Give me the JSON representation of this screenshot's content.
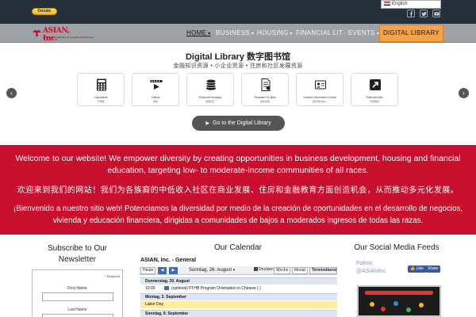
{
  "topbar": {
    "donate_label": "Donate",
    "language": "English",
    "social_icons": [
      "facebook-icon",
      "twitter-icon",
      "youtube-icon"
    ]
  },
  "nav": {
    "logo_text": "ASIAN, Inc.",
    "logo_tagline": "Empowering Minorities & Creating Opportunities",
    "items": [
      {
        "label": "HOME",
        "active": true
      },
      {
        "label": "BUSINESS",
        "active": false
      },
      {
        "label": "HOUSING",
        "active": false
      },
      {
        "label": "FINANCIAL LIT",
        "active": false
      },
      {
        "label": "EVENTS",
        "active": false
      }
    ],
    "digital_library": "DIGITAL LIBRARY",
    "accent_color": "#f5a24a"
  },
  "library": {
    "title": "Digital Library 数字图书馆",
    "subtitle": "金融知识资源 • 小企业资源 • 住房和社区发展资源",
    "tiles": [
      {
        "label": "Calculators",
        "sub": "计算器",
        "icon": "calculator-icon"
      },
      {
        "label": "Videos",
        "sub": "视频",
        "icon": "video-icon"
      },
      {
        "label": "Financial Glossary",
        "sub": "金融词汇",
        "icon": "coins-icon"
      },
      {
        "label": "Request For Bids",
        "sub": "招标请求",
        "icon": "document-icon"
      },
      {
        "label": "Contact Information Center",
        "sub": "联系信息中心",
        "icon": "contact-icon"
      },
      {
        "label": "External links",
        "sub": "外部链接",
        "icon": "external-link-icon"
      }
    ],
    "go_button": "Go to the Digital Library"
  },
  "welcome": {
    "english": "Welcome to our website! We empower diversity by creating opportunities in business development, housing and financial education, targeting low- to moderate-income communities of all races.",
    "chinese": "欢迎来到我们的网站！我们为各族裔的中低收入社区在商业发展、住房和金融教育方面创造机会，从而推动多元化发展。",
    "spanish": "¡Bienvenido a nuestro sitio web! Potenciamos la diversidad por medio de la creación de oportunidades en el desarrollo de negocios, vivienda y educación financiera, dirigidas a comunidades de bajos a moderados ingresos de todas las razas.",
    "band_color": "#c8102e"
  },
  "newsletter": {
    "title": "Subscribe to Our Newsletter",
    "required_note": "* Required",
    "first_name_label": "First Name",
    "last_name_label": "Last Name"
  },
  "calendar": {
    "title": "Our Calendar",
    "name": "ASIAN, Inc. - General",
    "today_label": "Heute",
    "current_date": "Sonntag, 26. August",
    "print_label": "Drucken",
    "week_label": "Woche",
    "month_label": "Monat",
    "agenda_label": "Terminübersicht",
    "rows": [
      {
        "type": "day",
        "text": "Donnerstag, 30. August"
      },
      {
        "type": "event",
        "time": "10:00",
        "text": "(optional) FTHB Program Orientation in Chinese ( )",
        "highlight": false
      },
      {
        "type": "day",
        "text": "Montag, 3. September"
      },
      {
        "type": "event",
        "time": "",
        "text": "Labor Day",
        "highlight": true
      },
      {
        "type": "day",
        "text": "Sonntag, 9. September"
      }
    ]
  },
  "social": {
    "title": "Our Social Media Feeds",
    "follow_text": "Follow",
    "handle": "@ASIANInc",
    "like_label": "Like",
    "share_label": "Share"
  }
}
